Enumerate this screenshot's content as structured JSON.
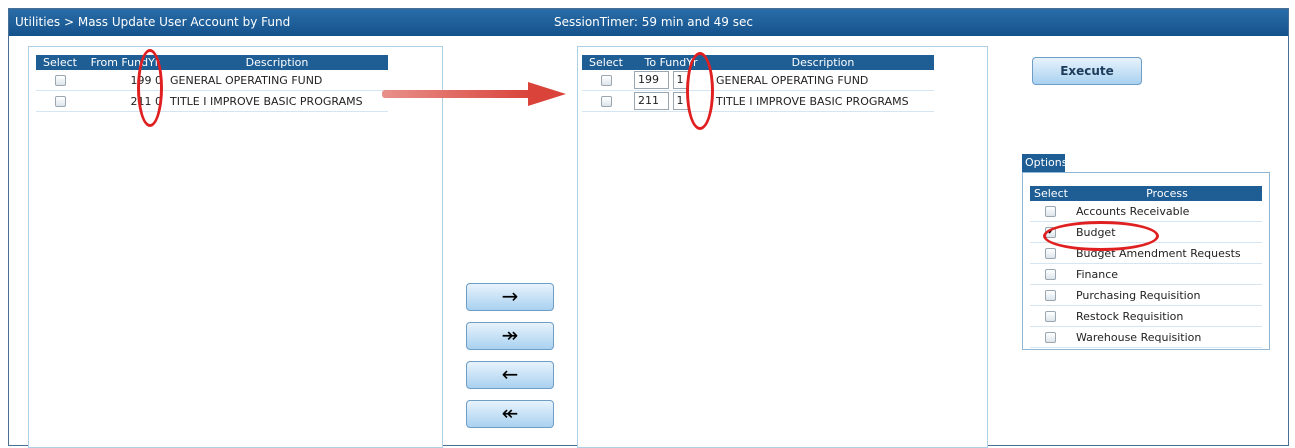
{
  "window": {
    "breadcrumb": "Utilities > Mass Update User Account by Fund",
    "session_timer": "SessionTimer: 59 min and 49 sec"
  },
  "from_grid": {
    "headers": [
      "Select",
      "From FundYr",
      "Description"
    ],
    "rows": [
      {
        "fund": "199",
        "yr": "0",
        "description": "GENERAL OPERATING FUND"
      },
      {
        "fund": "211",
        "yr": "0",
        "description": "TITLE I IMPROVE BASIC PROGRAMS"
      }
    ]
  },
  "to_grid": {
    "headers": [
      "Select",
      "To FundYr",
      "Description"
    ],
    "rows": [
      {
        "fund": "199",
        "yr": "1",
        "description": "GENERAL OPERATING FUND"
      },
      {
        "fund": "211",
        "yr": "1",
        "description": "TITLE I IMPROVE BASIC PROGRAMS"
      }
    ]
  },
  "move_buttons": {
    "move_selected": "→",
    "move_all": "↠",
    "remove_selected": "←",
    "remove_all": "↞"
  },
  "execute_label": "Execute",
  "options": {
    "tab_label": "Options",
    "headers": [
      "Select",
      "Process"
    ],
    "items": [
      {
        "label": "Accounts Receivable",
        "checked": false
      },
      {
        "label": "Budget",
        "checked": true
      },
      {
        "label": "Budget Amendment Requests",
        "checked": false
      },
      {
        "label": "Finance",
        "checked": false
      },
      {
        "label": "Purchasing Requisition",
        "checked": false
      },
      {
        "label": "Restock Requisition",
        "checked": false
      },
      {
        "label": "Warehouse Requisition",
        "checked": false
      }
    ]
  },
  "annotation_colors": {
    "callout": "#e02020"
  }
}
